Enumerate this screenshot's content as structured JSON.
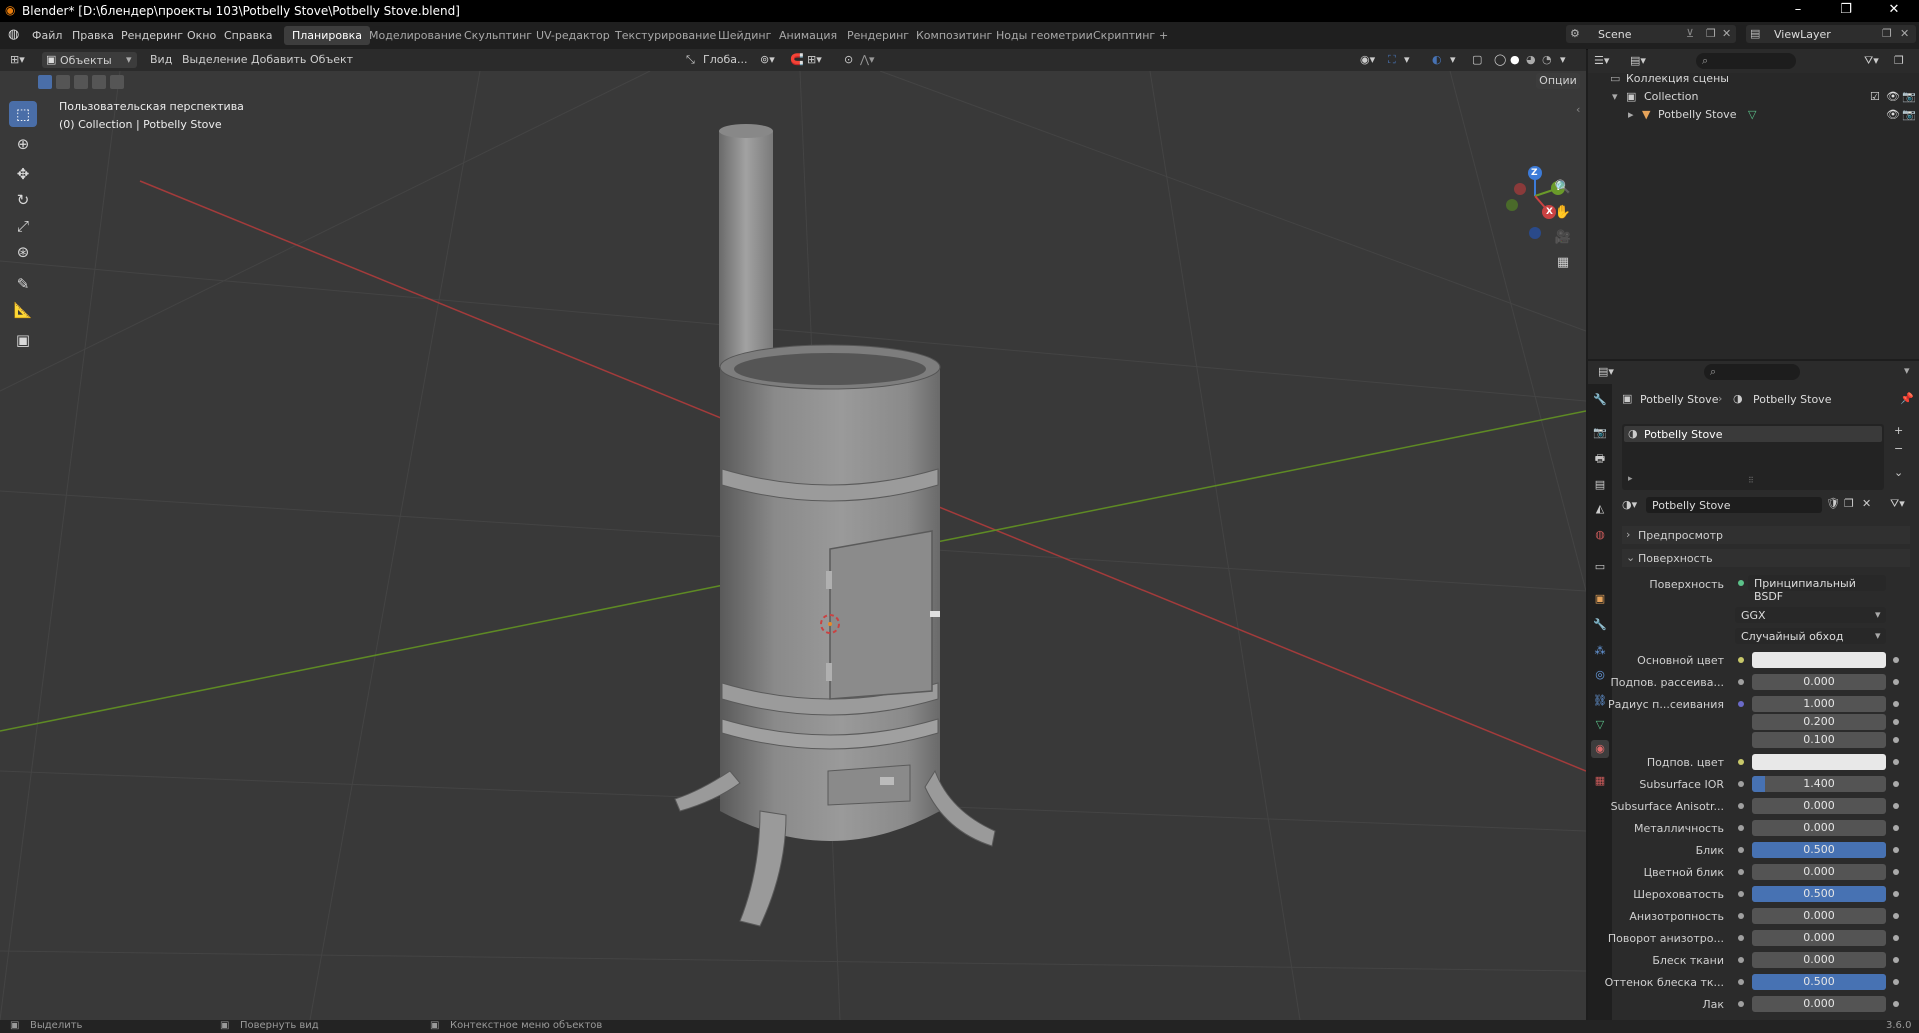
{
  "window": {
    "title": "Blender* [D:\\блендер\\проекты 103\\Potbelly Stove\\Potbelly Stove.blend]",
    "minimize": "–",
    "maximize": "❐",
    "close": "✕"
  },
  "menu": [
    "Файл",
    "Правка",
    "Рендеринг",
    "Окно",
    "Справка"
  ],
  "workspaces": [
    "Планировка",
    "Моделирование",
    "Скульптинг",
    "UV-редактор",
    "Текстурирование",
    "Шейдинг",
    "Анимация",
    "Рендеринг",
    "Композитинг",
    "Ноды геометрии",
    "Скриптинг"
  ],
  "active_workspace": "Планировка",
  "add_workspace": "+",
  "scene": {
    "name": "Scene",
    "view_layer": "ViewLayer"
  },
  "viewport_header": {
    "mode": "Объекты",
    "menus": [
      "Вид",
      "Выделение",
      "Добавить",
      "Объект"
    ],
    "orientation": "Глоба...",
    "options": "Опции"
  },
  "viewport": {
    "view_name": "Пользовательская перспектива",
    "collection_info": "(0) Collection | Potbelly Stove",
    "axis_gizmo": {
      "x": "X",
      "y": "Y",
      "z": "Z"
    }
  },
  "tools": [
    "select-box",
    "cursor",
    "move",
    "rotate",
    "scale",
    "transform",
    "annotate",
    "measure",
    "add-cube"
  ],
  "outliner": {
    "root": "Коллекция сцены",
    "collection": "Collection",
    "object": "Potbelly Stove"
  },
  "properties": {
    "breadcrumb": [
      "Potbelly Stove",
      "Potbelly Stove"
    ],
    "material_slot": "Potbelly Stove",
    "material_name": "Potbelly Stove",
    "sections": {
      "preview": "Предпросмотр",
      "surface": "Поверхность"
    },
    "surface_label": "Поверхность",
    "surface_value": "Принципиальный BSDF",
    "distribution": "GGX",
    "subsurface_method": "Случайный обход",
    "rows": [
      {
        "label": "Основной цвет",
        "type": "color",
        "color": "#e8e8e8",
        "dot": "#c8c86a"
      },
      {
        "label": "Подпов. рассеива...",
        "value": "0.000",
        "fill": 0
      },
      {
        "label": "Радиус п...сеивания",
        "value": "1.000",
        "fill": 0,
        "dot": "#6a6ac8"
      },
      {
        "label": "",
        "value": "0.200",
        "fill": 0,
        "nodot": true
      },
      {
        "label": "",
        "value": "0.100",
        "fill": 0,
        "nodot": true
      },
      {
        "label": "Подпов. цвет",
        "type": "color",
        "color": "#e8e8e8",
        "dot": "#c8c86a"
      },
      {
        "label": "Subsurface IOR",
        "value": "1.400",
        "fill": 0.1
      },
      {
        "label": "Subsurface Anisotr...",
        "value": "0.000",
        "fill": 0
      },
      {
        "label": "Металличность",
        "value": "0.000",
        "fill": 0
      },
      {
        "label": "Блик",
        "value": "0.500",
        "fill": 1
      },
      {
        "label": "Цветной блик",
        "value": "0.000",
        "fill": 0
      },
      {
        "label": "Шероховатость",
        "value": "0.500",
        "fill": 1
      },
      {
        "label": "Анизотропность",
        "value": "0.000",
        "fill": 0
      },
      {
        "label": "Поворот анизотро...",
        "value": "0.000",
        "fill": 0
      },
      {
        "label": "Блеск ткани",
        "value": "0.000",
        "fill": 0
      },
      {
        "label": "Оттенок блеска тк...",
        "value": "0.500",
        "fill": 1
      },
      {
        "label": "Лак",
        "value": "0.000",
        "fill": 0
      }
    ]
  },
  "status_bar": {
    "left": "Выделить",
    "middle": "Повернуть вид",
    "right": "Контекстное меню объектов",
    "version": "3.6.0"
  },
  "colors": {
    "accent": "#4772b3",
    "x_axis": "#c94242",
    "y_axis": "#6a9a2a",
    "z_axis": "#3c7bd8"
  }
}
